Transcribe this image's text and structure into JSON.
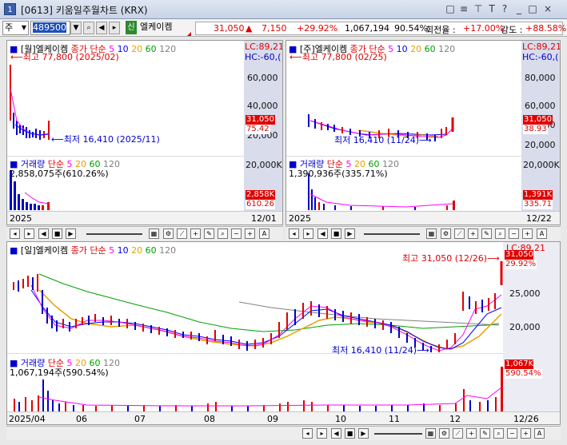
{
  "window": {
    "number": "1",
    "title": "[0613] 키움일주월차트 (KRX)",
    "controls": [
      "□",
      "≡",
      "T",
      "?",
      "_",
      "□",
      "×"
    ]
  },
  "toolbar": {
    "market": "주",
    "code": "489500",
    "shin_badge": "신",
    "stock_name": "엘케이켐",
    "price": "31,050",
    "change_arrow": "▲",
    "change": "7,150",
    "change_pct": "+29.92%",
    "volume": "1,067,194",
    "volume_pct": "90.54%",
    "turnover_label": "회전율 :",
    "turnover": "+17.00%",
    "strength_label": "강도 :",
    "strength": "+88.58%"
  },
  "monthly": {
    "title": "[월]엘케이켐",
    "ma_label": "종가 단순",
    "ma": [
      "5",
      "10",
      "20",
      "60",
      "120"
    ],
    "lc": "LC:89,21",
    "hc": "HC:-60,(",
    "high_note": "최고 77,800 (2025/02)",
    "low_note": "최저 16,410 (2025/11)",
    "y_ticks": [
      "60,000",
      "40,000",
      "20,000"
    ],
    "price_tag": "31,050",
    "pct_tag": "75.42",
    "vol_title": "거래량",
    "vol_ma_label": "단순",
    "vol_ma": [
      "5",
      "20",
      "60",
      "120"
    ],
    "vol_info": "2,858,075주(610.26%)",
    "vol_y": "20,000K",
    "vol_tag": "2,858K",
    "vol_pct_tag": "610.26",
    "x_start": "2025",
    "x_end": "12/01"
  },
  "weekly": {
    "title": "[주]엘케이켐",
    "ma_label": "종가 단순",
    "ma": [
      "5",
      "10",
      "20",
      "60",
      "120"
    ],
    "lc": "LC:89,21",
    "hc": "HC:-60,(",
    "high_note": "최고 77,800 (02/25)",
    "low_note": "최저 16,410 (11/24)",
    "y_ticks": [
      "80,000",
      "60,000",
      "40,000",
      "20,000"
    ],
    "price_tag": "31,050",
    "pct_tag": "38.93",
    "vol_title": "거래량",
    "vol_ma_label": "단순",
    "vol_ma": [
      "5",
      "20",
      "60",
      "120"
    ],
    "vol_info": "1,390,936주(335.71%)",
    "vol_y": "20,000K",
    "vol_tag": "1,391K",
    "vol_pct_tag": "335.71",
    "x_start": "2025",
    "x_end": "12/22"
  },
  "daily": {
    "title": "[일]엘케이켐",
    "ma_label": "종가 단순",
    "ma": [
      "5",
      "10",
      "20",
      "60",
      "120"
    ],
    "lc": "LC:89,21",
    "high_note": "최고 31,050 (12/26)",
    "low_note": "최저 16,410 (11/24)",
    "y_ticks": [
      "25,000",
      "20,000"
    ],
    "price_tag": "31,050",
    "pct_tag": "29.92%",
    "vol_title": "거래량",
    "vol_ma_label": "단순",
    "vol_ma": [
      "5",
      "20",
      "60",
      "120"
    ],
    "vol_info": "1,067,194주(590.54%)",
    "vol_tag": "1,067K",
    "vol_pct_tag": "590.54%",
    "x_labels": [
      "2025/04",
      "06",
      "07",
      "08",
      "09",
      "10",
      "11",
      "12"
    ],
    "x_end": "12/26"
  },
  "colors": {
    "ma5": "#ff00ff",
    "ma10": "#0000ff",
    "ma20": "#e8a000",
    "ma60": "#00a000",
    "ma120": "#808080",
    "up": "#e00000",
    "down": "#0000c8"
  }
}
